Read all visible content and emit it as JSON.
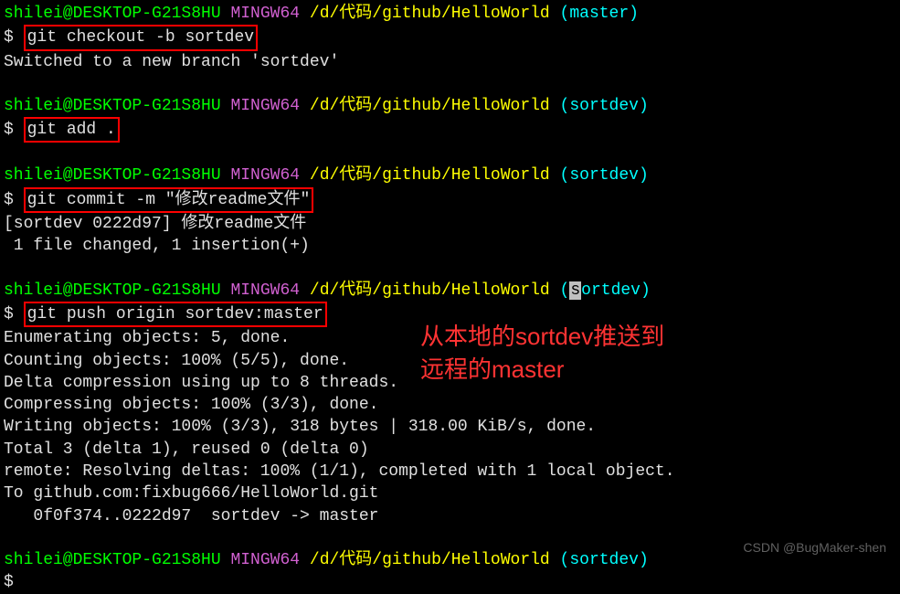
{
  "prompt1": {
    "user": "shilei@DESKTOP-G21S8HU",
    "env": "MINGW64",
    "path": "/d/代码/github/HelloWorld",
    "branch": "(master)"
  },
  "cmd1": {
    "dollar": "$ ",
    "command": "git checkout -b sortdev"
  },
  "output1": "Switched to a new branch 'sortdev'",
  "prompt2": {
    "user": "shilei@DESKTOP-G21S8HU",
    "env": "MINGW64",
    "path": "/d/代码/github/HelloWorld",
    "branch": "(sortdev)"
  },
  "cmd2": {
    "dollar": "$ ",
    "command": "git add ."
  },
  "prompt3": {
    "user": "shilei@DESKTOP-G21S8HU",
    "env": "MINGW64",
    "path": "/d/代码/github/HelloWorld",
    "branch": "(sortdev)"
  },
  "cmd3": {
    "dollar": "$ ",
    "command": "git commit -m \"修改readme文件\""
  },
  "output3a": "[sortdev 0222d97] 修改readme文件",
  "output3b": " 1 file changed, 1 insertion(+)",
  "prompt4": {
    "user": "shilei@DESKTOP-G21S8HU",
    "env": "MINGW64",
    "path": "/d/代码/github/HelloWorld",
    "branch_open": "(",
    "branch_cursor": "s",
    "branch_rest": "ortdev)"
  },
  "cmd4": {
    "dollar": "$ ",
    "command": "git push origin sortdev:master"
  },
  "output4": {
    "l1": "Enumerating objects: 5, done.",
    "l2": "Counting objects: 100% (5/5), done.",
    "l3": "Delta compression using up to 8 threads.",
    "l4": "Compressing objects: 100% (3/3), done.",
    "l5": "Writing objects: 100% (3/3), 318 bytes | 318.00 KiB/s, done.",
    "l6": "Total 3 (delta 1), reused 0 (delta 0)",
    "l7": "remote: Resolving deltas: 100% (1/1), completed with 1 local object.",
    "l8": "To github.com:fixbug666/HelloWorld.git",
    "l9": "   0f0f374..0222d97  sortdev -> master"
  },
  "prompt5": {
    "user": "shilei@DESKTOP-G21S8HU",
    "env": "MINGW64",
    "path": "/d/代码/github/HelloWorld",
    "branch": "(sortdev)"
  },
  "cmd5": {
    "dollar": "$"
  },
  "annotation": {
    "line1": "从本地的sortdev推送到",
    "line2": "远程的master"
  },
  "watermark": "CSDN @BugMaker-shen"
}
